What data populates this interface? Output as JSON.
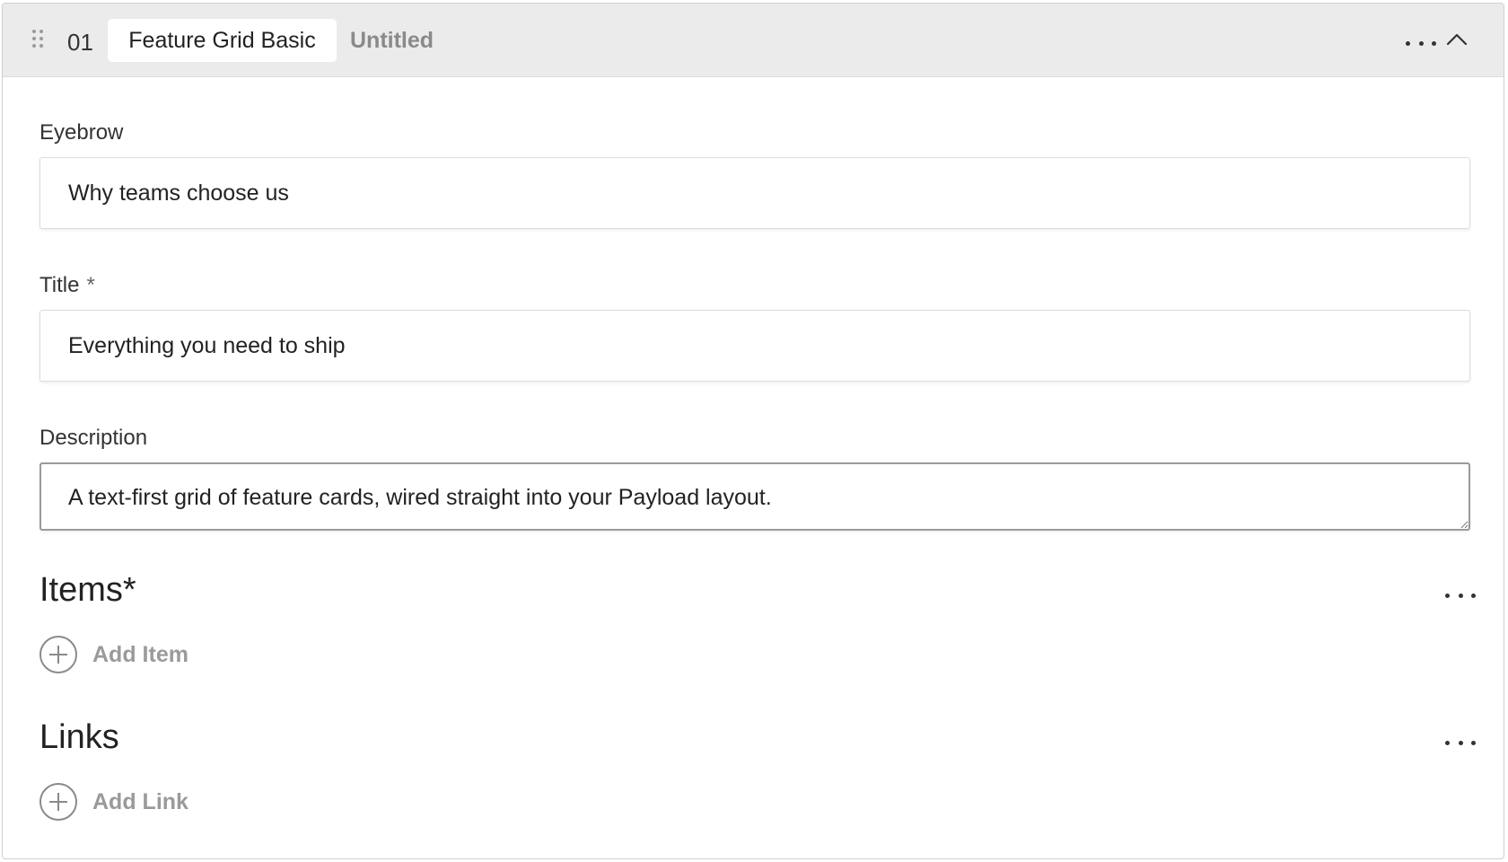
{
  "block": {
    "row_number": "01",
    "block_type": "Feature Grid Basic",
    "row_label": "Untitled"
  },
  "fields": {
    "eyebrow": {
      "label": "Eyebrow",
      "value": "Why teams choose us"
    },
    "title": {
      "label": "Title",
      "required_marker": "*",
      "value": "Everything you need to ship"
    },
    "description": {
      "label": "Description",
      "value": "A text-first grid of feature cards, wired straight into your Payload layout."
    }
  },
  "items": {
    "title": "Items*",
    "add_label": "Add Item"
  },
  "links": {
    "title": "Links",
    "add_label": "Add Link"
  },
  "icons": {
    "drag": "drag-handle-icon",
    "more": "more-horizontal-icon",
    "collapse": "chevron-up-icon",
    "add": "plus-circle-icon"
  },
  "colors": {
    "header_bg": "#ebebeb",
    "muted_text": "#8a8a8a",
    "text": "#222222"
  }
}
